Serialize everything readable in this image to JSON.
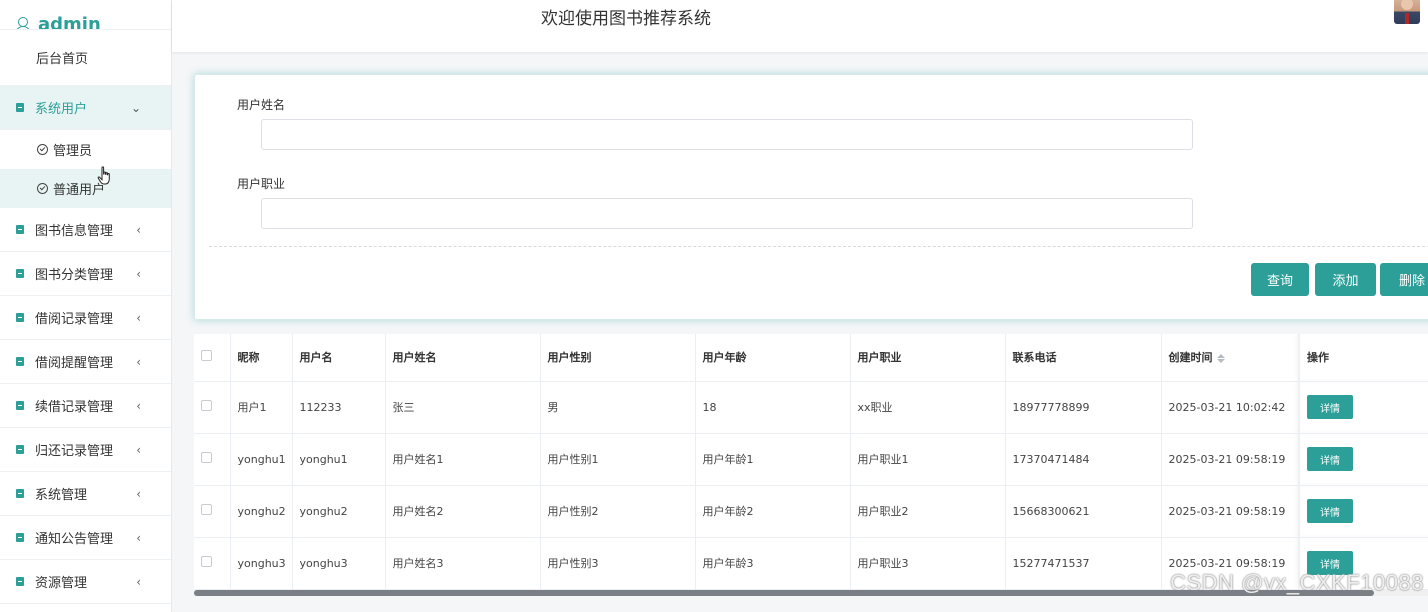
{
  "app": {
    "brand": "admin",
    "header_title": "欢迎使用图书推荐系统"
  },
  "sidebar": {
    "home": "后台首页",
    "system_users": {
      "label": "系统用户",
      "children": [
        "管理员",
        "普通用户"
      ]
    },
    "items": [
      "图书信息管理",
      "图书分类管理",
      "借阅记录管理",
      "借阅提醒管理",
      "续借记录管理",
      "归还记录管理",
      "系统管理",
      "通知公告管理",
      "资源管理"
    ]
  },
  "search": {
    "name_label": "用户姓名",
    "name_value": "",
    "job_label": "用户职业",
    "job_value": "",
    "query_btn": "查询",
    "add_btn": "添加",
    "delete_btn": "删除"
  },
  "table": {
    "columns": [
      "昵称",
      "用户名",
      "用户姓名",
      "用户性别",
      "用户年龄",
      "用户职业",
      "联系电话",
      "创建时间",
      "操作"
    ],
    "rows": [
      [
        "用户1",
        "112233",
        "张三",
        "男",
        "18",
        "xx职业",
        "18977778899",
        "2025-03-21 10:02:42"
      ],
      [
        "yonghu1",
        "yonghu1",
        "用户姓名1",
        "用户性别1",
        "用户年龄1",
        "用户职业1",
        "17370471484",
        "2025-03-21 09:58:19"
      ],
      [
        "yonghu2",
        "yonghu2",
        "用户姓名2",
        "用户性别2",
        "用户年龄2",
        "用户职业2",
        "15668300621",
        "2025-03-21 09:58:19"
      ],
      [
        "yonghu3",
        "yonghu3",
        "用户姓名3",
        "用户性别3",
        "用户年龄3",
        "用户职业3",
        "15277471537",
        "2025-03-21 09:58:19"
      ]
    ],
    "detail_btn": "详情"
  },
  "watermark": "CSDN @vx_CXKF10088",
  "colors": {
    "accent": "#2b9f98",
    "active_bg": "#e8f4f3"
  }
}
